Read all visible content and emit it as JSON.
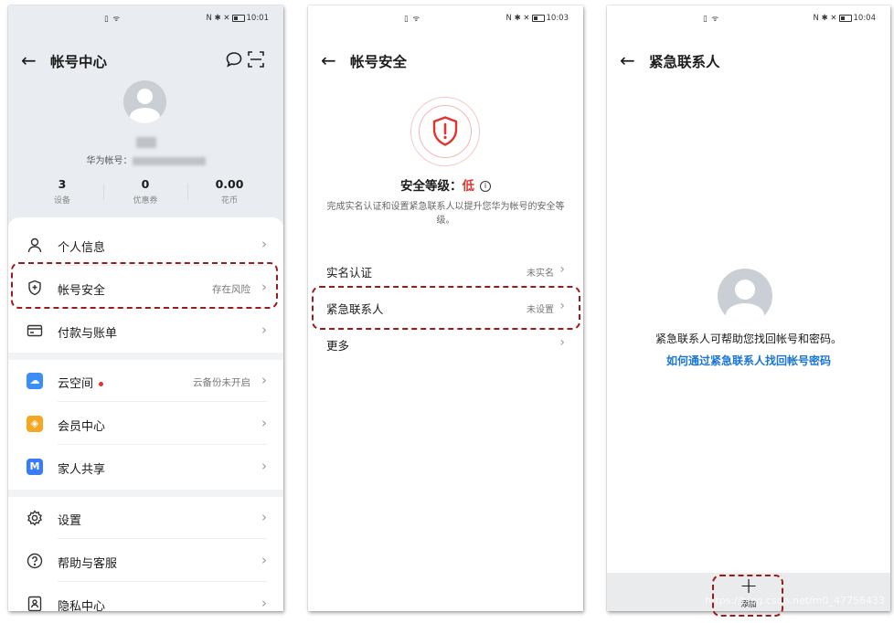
{
  "panels": [
    {
      "status": {
        "left": "▯ ᯤ",
        "right": "N ✱ ✕",
        "time": "10:01"
      },
      "title": "帐号中心",
      "profile": {
        "account_label": "华为帐号："
      },
      "stats": [
        {
          "value": "3",
          "label": "设备"
        },
        {
          "value": "0",
          "label": "优惠券"
        },
        {
          "value": "0.00",
          "label": "花币"
        }
      ],
      "items": [
        {
          "label": "个人信息",
          "value": "",
          "icon": "user-icon"
        },
        {
          "label": "帐号安全",
          "value": "存在风险",
          "icon": "shield-icon"
        },
        {
          "label": "付款与账单",
          "value": "",
          "icon": "card-icon"
        },
        {
          "label": "云空间",
          "value": "云备份未开启",
          "icon": "cloud-icon",
          "color": "#3a8ef6"
        },
        {
          "label": "会员中心",
          "value": "",
          "icon": "diamond-icon",
          "color": "#f5a623"
        },
        {
          "label": "家人共享",
          "value": "",
          "icon": "family-icon",
          "color": "#3a7bf6"
        },
        {
          "label": "设置",
          "value": "",
          "icon": "gear-icon"
        },
        {
          "label": "帮助与客服",
          "value": "",
          "icon": "help-icon"
        },
        {
          "label": "隐私中心",
          "value": "",
          "icon": "privacy-icon"
        }
      ]
    },
    {
      "status": {
        "left": "▯ ᯤ",
        "right": "N ✱ ✕",
        "time": "10:03"
      },
      "title": "帐号安全",
      "level_label": "安全等级：",
      "level_value": "低",
      "desc": "完成实名认证和设置紧急联系人以提升您华为帐号的安全等级。",
      "items": [
        {
          "label": "实名认证",
          "value": "未实名"
        },
        {
          "label": "紧急联系人",
          "value": "未设置"
        },
        {
          "label": "更多",
          "value": ""
        }
      ]
    },
    {
      "status": {
        "left": "▯ ᯤ",
        "right": "N ✱ ✕",
        "time": "10:04"
      },
      "title": "紧急联系人",
      "empty_text": "紧急联系人可帮助您找回帐号和密码。",
      "help_link": "如何通过紧急联系人找回帐号密码",
      "add_label": "添加",
      "watermark": "https://blog.csdn.net/m0_47756433"
    }
  ],
  "colors": {
    "danger": "#e0342c",
    "link": "#1976d2",
    "highlight": "#9b1b1b"
  }
}
